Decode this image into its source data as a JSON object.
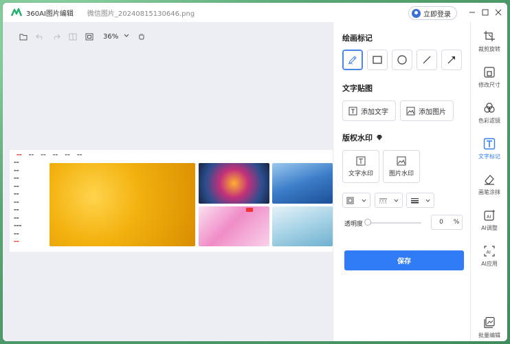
{
  "app": {
    "name": "360AI图片编辑",
    "file_name": "微信图片_20240815130646.png",
    "login_label": "立即登录"
  },
  "toolbar": {
    "zoom": "36%"
  },
  "panel": {
    "draw_title": "绘画标记",
    "text_sticker_title": "文字贴图",
    "add_text": "添加文字",
    "add_image": "添加图片",
    "watermark_title": "版权水印",
    "text_watermark": "文字水印",
    "image_watermark": "图片水印",
    "opacity_label": "透明度",
    "opacity_value": "0",
    "opacity_unit": "%",
    "opacity_fraction": 0,
    "save_label": "保存"
  },
  "tools": [
    {
      "label": "裁剪旋转",
      "icon": "crop-rotate-icon"
    },
    {
      "label": "修改尺寸",
      "icon": "resize-icon"
    },
    {
      "label": "色彩滤镜",
      "icon": "color-filter-icon"
    },
    {
      "label": "文字标记",
      "icon": "text-mark-icon"
    },
    {
      "label": "画笔涂抹",
      "icon": "eraser-brush-icon"
    },
    {
      "label": "AI调整",
      "icon": "ai-adjust-icon"
    },
    {
      "label": "AI应用",
      "icon": "ai-apply-icon"
    },
    {
      "label": "批量编辑",
      "icon": "batch-edit-icon"
    }
  ],
  "colors": {
    "accent": "#2f7cf6",
    "active_border": "#4a86e8"
  }
}
